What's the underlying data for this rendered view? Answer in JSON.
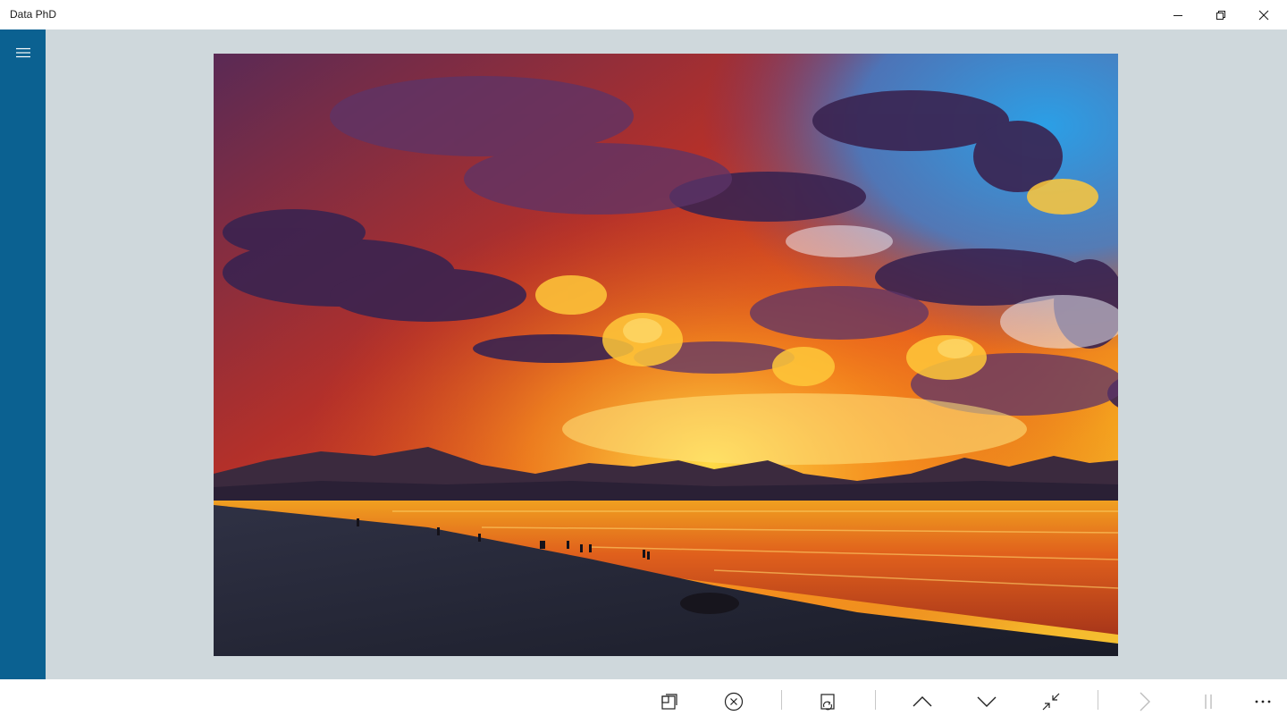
{
  "window": {
    "title": "Data PhD",
    "controls": [
      "minimize-icon",
      "restore-icon",
      "close-icon"
    ]
  },
  "sidebar": {
    "background": "#0b6191",
    "menu_icon": "hamburger-icon"
  },
  "viewer": {
    "background": "#cfd8dc",
    "image": "sunset-beach-photo"
  },
  "toolbar": {
    "buttons": [
      {
        "name": "crop-icon"
      },
      {
        "name": "cancel-icon"
      },
      {
        "name": "rotate-icon"
      },
      {
        "name": "previous-up-icon"
      },
      {
        "name": "next-down-icon"
      },
      {
        "name": "collapse-icon"
      },
      {
        "name": "play-icon",
        "disabled": true
      },
      {
        "name": "pause-icon",
        "disabled": true
      },
      {
        "name": "more-icon"
      }
    ]
  }
}
